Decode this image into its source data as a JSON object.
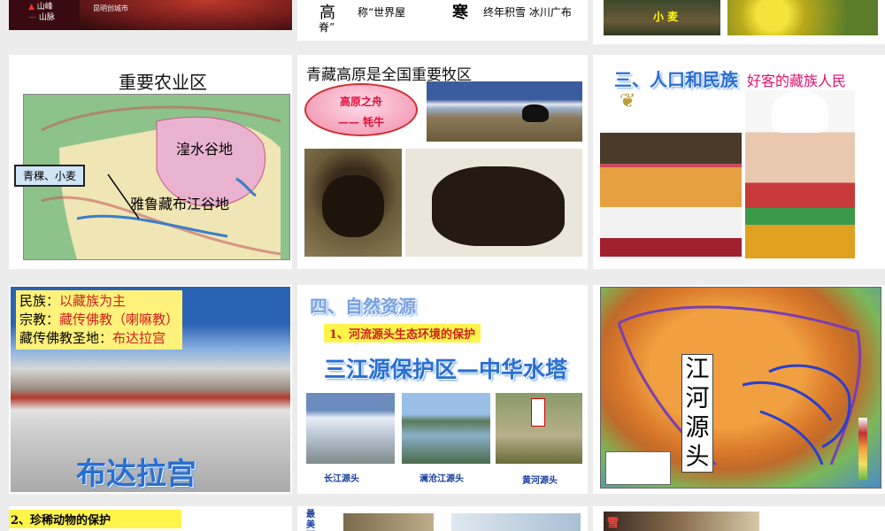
{
  "colors": {
    "map_green": "#8dc38a",
    "map_pink": "#e9b3d0",
    "map_tan": "#f0e5b4",
    "ellipse_red": "#e24a6a",
    "label_yellow": "#fff32a",
    "art_blue": "#2a6fd1"
  },
  "slide1": {
    "legend": [
      "山峰",
      "山脉"
    ],
    "caption": "昆明创城市"
  },
  "slide2": {
    "left_char": "高",
    "left_cont": "脊”",
    "mid_text": "称“世界屋",
    "right_char": "寒",
    "right_text": "终年积雪 冰川广布"
  },
  "slide4": {
    "title": "重要农业区",
    "region1": "湟水谷地",
    "region2": "雅鲁藏布江谷地",
    "crop_label": "青稞、小麦"
  },
  "slide5": {
    "title": "青藏高原是全国重要牧区",
    "ellipse_line1": "高原之舟",
    "ellipse_line2": "——  牦牛"
  },
  "slide6": {
    "heading": "三、人口和民族",
    "subtitle": "好客的藏族人民"
  },
  "slide7": {
    "line1_label": "民族：",
    "line1_value": "以藏族为主",
    "line2_label": "宗教：",
    "line2_value": "藏传佛教（喇嘛教）",
    "line3_label": "藏传佛教圣地：",
    "line3_value": "布达拉宫",
    "art_caption": "布达拉宫"
  },
  "slide8": {
    "heading": "四、自然资源",
    "subheading": "1、河流源头生态环境的保护",
    "banner": "三江源保护区—中华水塔",
    "captions": [
      "长江源头",
      "澜沧江源头",
      "黄河源头"
    ]
  },
  "slide9": {
    "label_chars": [
      "江",
      "河",
      "源",
      "头"
    ]
  },
  "slide10": {
    "subheading": "2、珍稀动物的保护"
  },
  "slide11": {
    "side_text": "最美丽的"
  },
  "slide12": {
    "side_text": "雪"
  }
}
